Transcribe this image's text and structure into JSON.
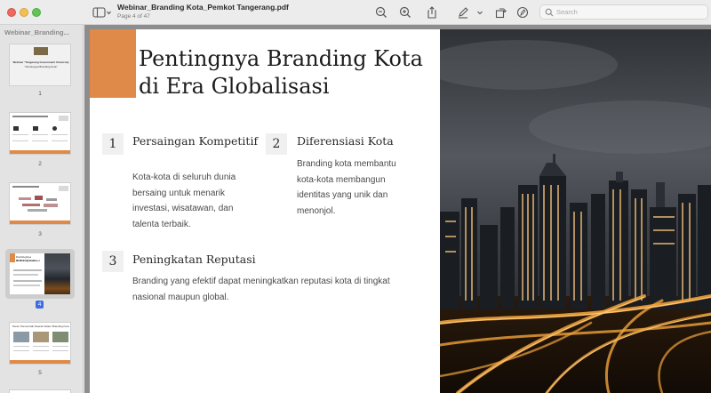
{
  "window": {
    "doc_title": "Webinar_Branding Kota_Pemkot Tangerang.pdf",
    "page_indicator": "Page 4 of 47"
  },
  "search": {
    "placeholder": "Search"
  },
  "sidebar": {
    "title": "Webinar_Branding...",
    "thumbnails": [
      {
        "label": "1",
        "caption_line1": "Webinar \"Tangerang Government University",
        "caption_line2": "\"Pentingnya Branding Kota\""
      },
      {
        "label": "2"
      },
      {
        "label": "3"
      },
      {
        "label": "4",
        "selected": true,
        "caption_line1": "Pentingnya Branding Kota",
        "caption_line2": "di Era Globalisasi"
      },
      {
        "label": "5",
        "caption_line1": "Peran Pemerintah Daerah dalam Branding Kota"
      }
    ]
  },
  "slide": {
    "title_line1": "Pentingnya Branding Kota",
    "title_line2": "di Era Globalisasi",
    "accent_color": "#e08a49",
    "items": [
      {
        "number": "1",
        "title": "Persaingan Kompetitif",
        "body": [
          "Kota-kota di seluruh dunia",
          "bersaing untuk menarik",
          "investasi, wisatawan, dan",
          "talenta terbaik."
        ]
      },
      {
        "number": "2",
        "title": "Diferensiasi Kota",
        "body": [
          "Branding kota membantu",
          "kota-kota membangun",
          "identitas yang unik dan",
          "menonjol."
        ]
      },
      {
        "number": "3",
        "title": "Peningkatan Reputasi",
        "body": [
          "Branding yang efektif dapat meningkatkan reputasi kota di tingkat",
          "nasional maupun global."
        ]
      }
    ]
  }
}
